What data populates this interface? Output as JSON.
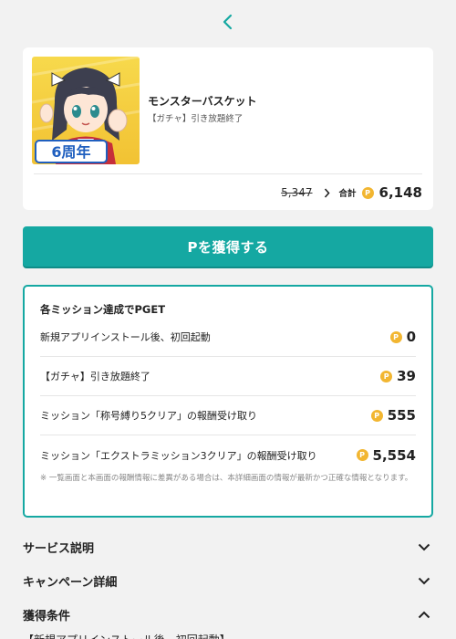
{
  "app": {
    "name": "モンスターバスケット",
    "subtitle": "【ガチャ】引き放題終了",
    "banner_text": "6周年",
    "old_price": "5,347",
    "total_label": "合計",
    "total_value": "6,148"
  },
  "coin_symbol": "P",
  "get_button_label": "Pを獲得する",
  "missions": {
    "title": "各ミッション達成でPGET",
    "items": [
      {
        "name": "新規アプリインストール後、初回起動",
        "value": "0"
      },
      {
        "name": "【ガチャ】引き放題終了",
        "value": "39"
      },
      {
        "name": "ミッション「称号縛り5クリア」の報酬受け取り",
        "value": "555"
      },
      {
        "name": "ミッション「エクストラミッション3クリア」の報酬受け取り",
        "value": "5,554"
      }
    ],
    "note": "※ 一覧画面と本画面の報酬情報に差異がある場合は、本詳細画面の情報が最新かつ正確な情報となります。"
  },
  "sections": [
    {
      "label": "サービス説明",
      "icon": "chevron-down-icon"
    },
    {
      "label": "キャンペーン詳細",
      "icon": "chevron-down-icon"
    },
    {
      "label": "獲得条件",
      "icon": "chevron-up-icon"
    }
  ],
  "conditions_text": "【新規アプリインストール後、初回起動】",
  "colors": {
    "accent": "#15a8a2",
    "coin": "#f2b631",
    "background": "#f2f2f2"
  }
}
